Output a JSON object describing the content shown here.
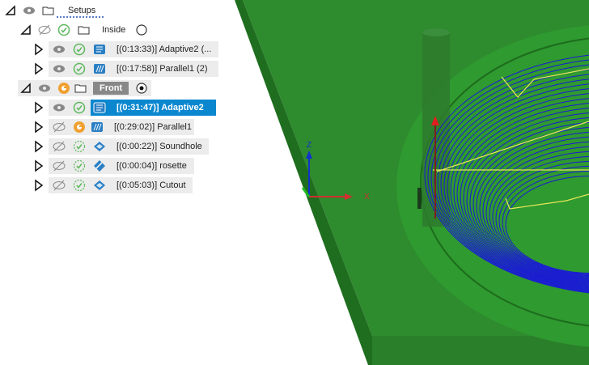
{
  "browser": {
    "setups_label": "Setups",
    "setup_inside": {
      "name": "Inside",
      "ops": [
        {
          "label": "[(0:13:33)] Adaptive2 (..."
        },
        {
          "label": "[(0:17:58)] Parallel1 (2)"
        }
      ]
    },
    "setup_front": {
      "name": "Front",
      "ops": [
        {
          "label": "[(0:31:47)] Adaptive2"
        },
        {
          "label": "[(0:29:02)] Parallel1"
        },
        {
          "label": "[(0:00:22)] Soundhole"
        },
        {
          "label": "[(0:00:04)] rosette"
        },
        {
          "label": "[(0:05:03)] Cutout"
        }
      ]
    }
  },
  "triad": {
    "x_label": "X",
    "z_label": "Z"
  },
  "colors": {
    "stock_green": "#2f8a2f",
    "toolpath_blue": "#1a1ad6",
    "selection_blue": "#0a87cf",
    "check_green": "#5cb85c",
    "warning_orange": "#f0a030"
  }
}
